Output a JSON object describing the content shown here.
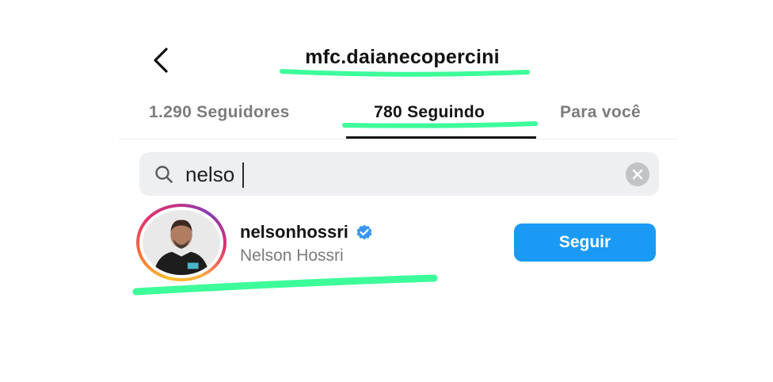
{
  "header": {
    "back_icon": "chevron-left-icon",
    "title": "mfc.daianecopercini"
  },
  "tabs": [
    {
      "label": "1.290 Seguidores",
      "active": false
    },
    {
      "label": "780 Seguindo",
      "active": true
    },
    {
      "label": "Para você",
      "active": false
    }
  ],
  "search": {
    "value": "nelso",
    "icon": "search-icon",
    "clear_icon": "clear-icon"
  },
  "results": [
    {
      "username": "nelsonhossri",
      "verified": true,
      "full_name": "Nelson Hossri",
      "follow_label": "Seguir",
      "story_ring": true
    }
  ],
  "colors": {
    "accent_blue": "#1a9af5",
    "highlighter_green": "#3dfc9a",
    "verified_blue": "#3897f0"
  }
}
